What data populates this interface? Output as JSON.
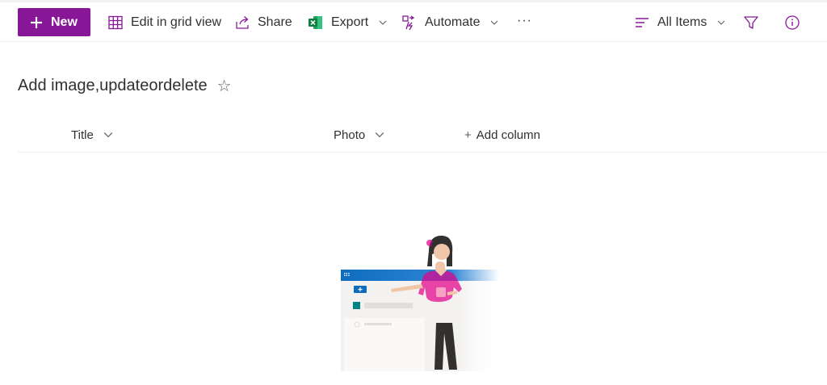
{
  "toolbar": {
    "new_label": "New",
    "edit_grid_label": "Edit in grid view",
    "share_label": "Share",
    "export_label": "Export",
    "automate_label": "Automate",
    "more_label": "···",
    "view_label": "All Items"
  },
  "list": {
    "title": "Add image,updateordelete",
    "favorite_icon": "☆",
    "columns": [
      {
        "label": "Title"
      },
      {
        "label": "Photo"
      }
    ],
    "add_column_label": "Add column",
    "add_column_icon": "+"
  },
  "colors": {
    "accent": "#881798",
    "excel": "#107c41",
    "blue": "#0f6cbd"
  }
}
